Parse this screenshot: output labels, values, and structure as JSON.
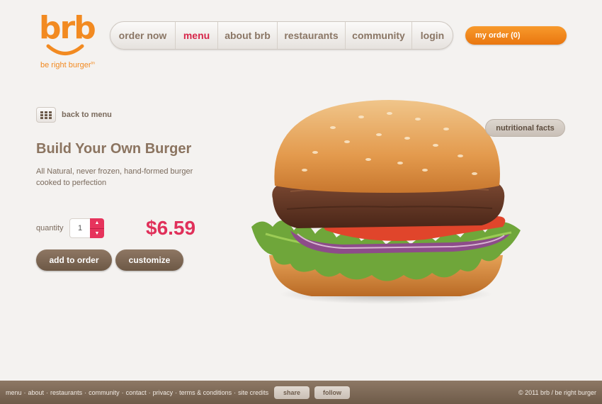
{
  "brand": {
    "logo_text": "brb",
    "tagline": "be right burger",
    "tagline_mark": "tm"
  },
  "nav": {
    "items": [
      {
        "label": "order now"
      },
      {
        "label": "menu",
        "active": true
      },
      {
        "label": "about brb"
      },
      {
        "label": "restaurants"
      },
      {
        "label": "community"
      },
      {
        "label": "login"
      }
    ]
  },
  "cart": {
    "label": "my order (0)"
  },
  "product": {
    "back_label": "back to menu",
    "title": "Build Your Own Burger",
    "description": "All Natural, never frozen, hand-formed burger cooked to perfection",
    "quantity_label": "quantity",
    "quantity_value": "1",
    "price": "$6.59",
    "add_label": "add to order",
    "customize_label": "customize",
    "nutrition_label": "nutritional facts",
    "image_icon": "burger-photo"
  },
  "footer": {
    "links": [
      "menu",
      "about",
      "restaurants",
      "community",
      "contact",
      "privacy",
      "terms & conditions",
      "site credits"
    ],
    "share_label": "share",
    "follow_label": "follow",
    "copyright": "© 2011 brb / be right burger"
  },
  "colors": {
    "brand_orange": "#f28a21",
    "accent_pink": "#e0305a",
    "brown": "#7a6a5c",
    "background": "#f4f2f0"
  }
}
